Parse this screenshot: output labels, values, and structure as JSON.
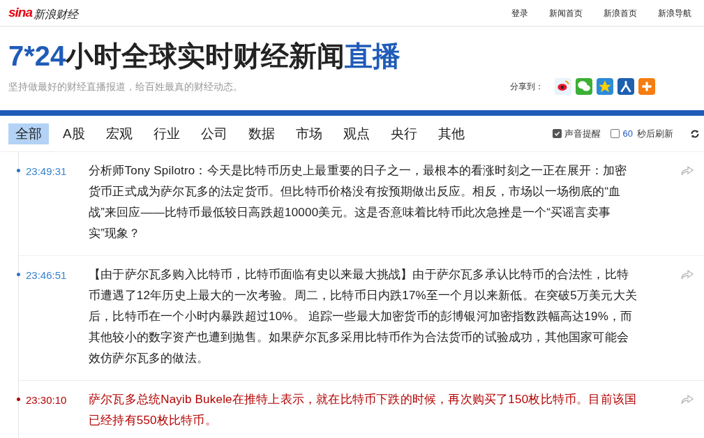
{
  "header": {
    "logo_mark": "sina",
    "logo_text": "新浪财经",
    "links": [
      "登录",
      "新闻首页",
      "新浪首页",
      "新浪导航"
    ]
  },
  "title": [
    {
      "text": "7*24",
      "highlight": true
    },
    {
      "text": "小时全球实时财经新闻",
      "highlight": false
    },
    {
      "text": "直播",
      "highlight": true
    }
  ],
  "subtitle": "坚持做最好的财经直播报道，给百姓最真的财经动态。",
  "share": {
    "label": "分享到：",
    "services": [
      {
        "kind": "weibo"
      },
      {
        "kind": "wechat"
      },
      {
        "kind": "qzone"
      },
      {
        "kind": "renren"
      },
      {
        "kind": "more"
      }
    ]
  },
  "tabs": [
    {
      "label": "全部",
      "selected": true
    },
    {
      "label": "A股",
      "selected": false
    },
    {
      "label": "宏观",
      "selected": false
    },
    {
      "label": "行业",
      "selected": false
    },
    {
      "label": "公司",
      "selected": false
    },
    {
      "label": "数据",
      "selected": false
    },
    {
      "label": "市场",
      "selected": false
    },
    {
      "label": "观点",
      "selected": false
    },
    {
      "label": "央行",
      "selected": false
    },
    {
      "label": "其他",
      "selected": false
    }
  ],
  "options": {
    "sound": {
      "label": "声音提醒",
      "checked": true
    },
    "refresh": {
      "checked": false,
      "seconds": "60",
      "label": "秒后刷新"
    }
  },
  "news": [
    {
      "time": "23:49:31",
      "important": false,
      "text": "分析师Tony Spilotro：今天是比特币历史上最重要的日子之一，最根本的看涨时刻之一正在展开：加密货币正式成为萨尔瓦多的法定货币。但比特币价格没有按预期做出反应。相反，市场以一场彻底的“血战”来回应——比特币最低较日高跌超10000美元。这是否意味着比特币此次急挫是一个“买谣言卖事实”现象？"
    },
    {
      "time": "23:46:51",
      "important": false,
      "text": "【由于萨尔瓦多购入比特币，比特币面临有史以来最大挑战】由于萨尔瓦多承认比特币的合法性，比特币遭遇了12年历史上最大的一次考验。周二，比特币日内跌17%至一个月以来新低。在突破5万美元大关后，比特币在一个小时内暴跌超过10%。 追踪一些最大加密货币的彭博银河加密指数跌幅高达19%，而其他较小的数字资产也遭到抛售。如果萨尔瓦多采用比特币作为合法货币的试验成功，其他国家可能会效仿萨尔瓦多的做法。"
    },
    {
      "time": "23:30:10",
      "important": true,
      "text": "萨尔瓦多总统Nayib Bukele在推特上表示，就在比特币下跌的时候，再次购买了150枚比特币。目前该国已经持有550枚比特币。"
    }
  ]
}
